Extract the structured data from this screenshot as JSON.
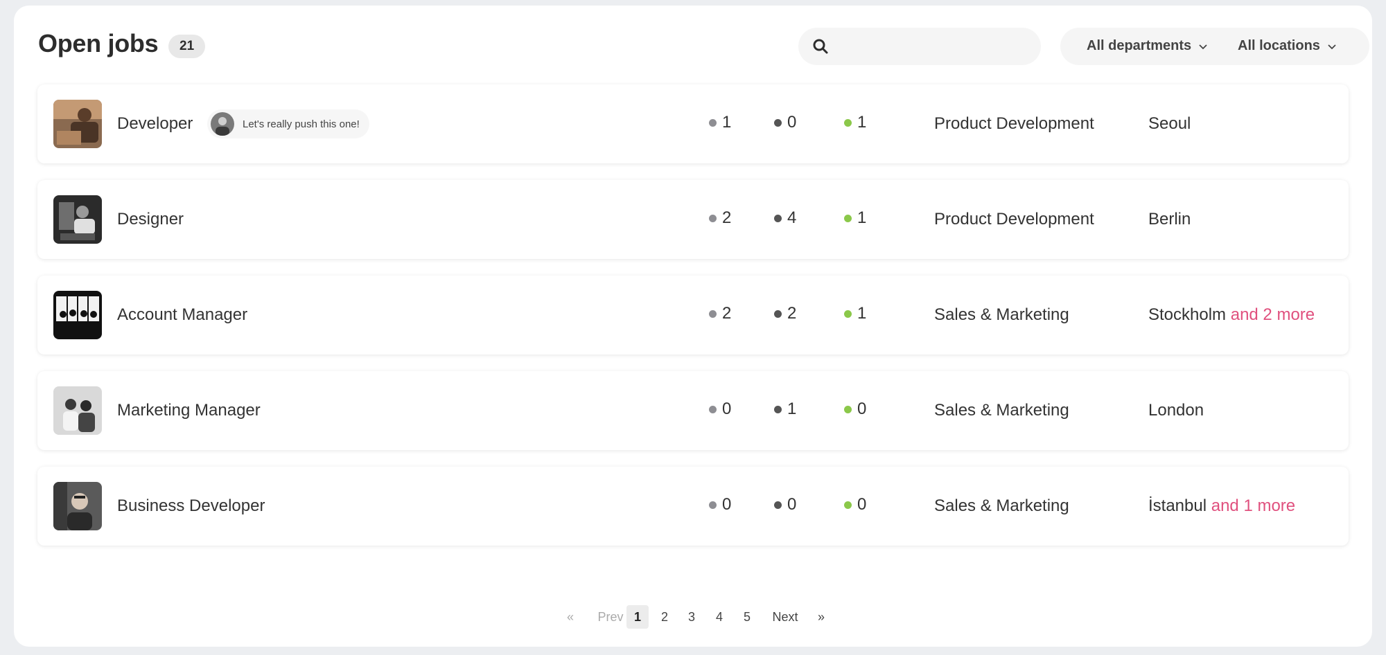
{
  "header": {
    "title": "Open jobs",
    "count": "21",
    "search": {
      "value": "",
      "placeholder": ""
    },
    "filters": {
      "department": "All departments",
      "location": "All locations"
    }
  },
  "jobs": [
    {
      "title": "Developer",
      "note": "Let's really push this one!",
      "stat1": "1",
      "stat2": "0",
      "stat3": "1",
      "department": "Product Development",
      "location": "Seoul",
      "location_more": ""
    },
    {
      "title": "Designer",
      "note": "",
      "stat1": "2",
      "stat2": "4",
      "stat3": "1",
      "department": "Product Development",
      "location": "Berlin",
      "location_more": ""
    },
    {
      "title": "Account Manager",
      "note": "",
      "stat1": "2",
      "stat2": "2",
      "stat3": "1",
      "department": "Sales & Marketing",
      "location": "Stockholm",
      "location_more": "and 2 more"
    },
    {
      "title": "Marketing Manager",
      "note": "",
      "stat1": "0",
      "stat2": "1",
      "stat3": "0",
      "department": "Sales & Marketing",
      "location": "London",
      "location_more": ""
    },
    {
      "title": "Business Developer",
      "note": "",
      "stat1": "0",
      "stat2": "0",
      "stat3": "0",
      "department": "Sales & Marketing",
      "location": "İstanbul",
      "location_more": "and 1 more"
    }
  ],
  "pagination": {
    "first": "«",
    "prev": "Prev",
    "pages": [
      "1",
      "2",
      "3",
      "4",
      "5"
    ],
    "current": "1",
    "next": "Next",
    "last": "»"
  },
  "colors": {
    "accent_link": "#e0507e",
    "dot_gray": "#8e8e93",
    "dot_dark": "#555555",
    "dot_green": "#8bc84a"
  }
}
